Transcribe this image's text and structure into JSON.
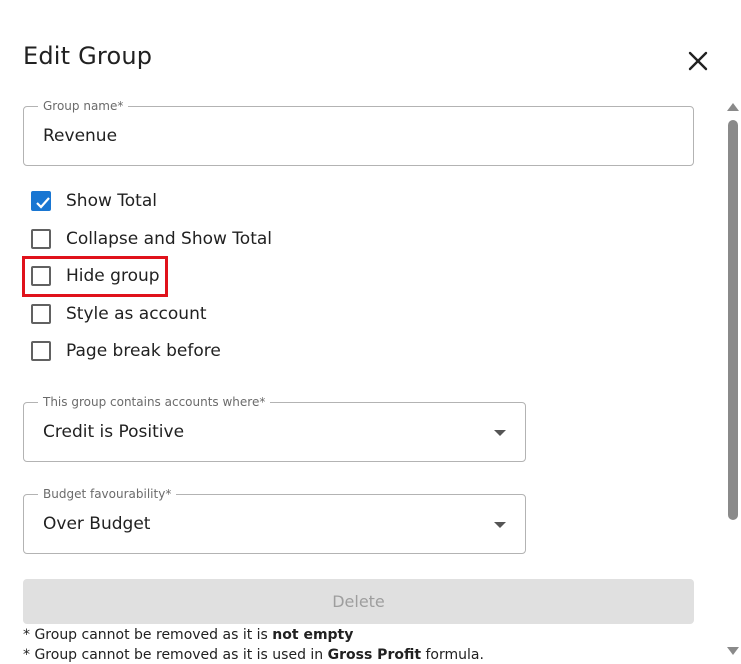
{
  "dialog": {
    "title": "Edit Group"
  },
  "group_name": {
    "label": "Group name*",
    "value": "Revenue"
  },
  "checkboxes": [
    {
      "label": "Show Total",
      "checked": true
    },
    {
      "label": "Collapse and Show Total",
      "checked": false
    },
    {
      "label": "Hide group",
      "checked": false
    },
    {
      "label": "Style as account",
      "checked": false
    },
    {
      "label": "Page break before",
      "checked": false
    }
  ],
  "accounts_select": {
    "label": "This group contains accounts where*",
    "value": "Credit is Positive"
  },
  "budget_select": {
    "label": "Budget favourability*",
    "value": "Over Budget"
  },
  "delete_button": {
    "label": "Delete"
  },
  "notes": {
    "note1_prefix": "* Group cannot be removed as it is ",
    "note1_bold": "not empty",
    "note2_prefix": "* Group cannot be removed as it is used in ",
    "note2_bold": "Gross Profit",
    "note2_suffix": " formula."
  },
  "colors": {
    "accent": "#1976d2",
    "highlight": "#e0121b"
  }
}
